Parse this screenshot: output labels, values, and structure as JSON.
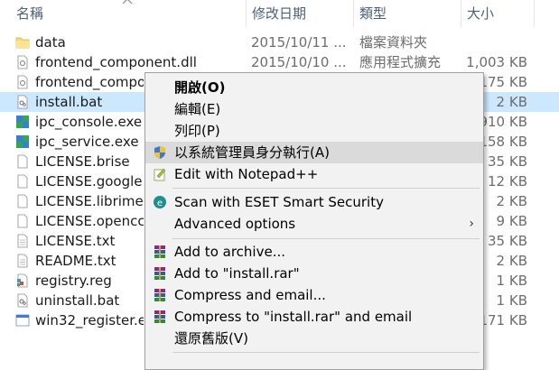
{
  "columns": {
    "name": "名稱",
    "date": "修改日期",
    "type": "類型",
    "size": "大小"
  },
  "files": [
    {
      "name": "data",
      "date": "2015/10/11 ...",
      "type": "檔案資料夾",
      "size": "",
      "icon": "folder-icon"
    },
    {
      "name": "frontend_component.dll",
      "date": "2015/10/10 ...",
      "type": "應用程式擴充",
      "size": "1,003 KB",
      "icon": "dll-file-icon"
    },
    {
      "name": "frontend_compo",
      "date": "",
      "type": "",
      "size": "175 KB",
      "icon": "dll-file-icon"
    },
    {
      "name": "install.bat",
      "date": "",
      "type": "",
      "size": "2 KB",
      "icon": "bat-file-icon"
    },
    {
      "name": "ipc_console.exe",
      "date": "",
      "type": "",
      "size": "910 KB",
      "icon": "exe-file-icon"
    },
    {
      "name": "ipc_service.exe",
      "date": "",
      "type": "",
      "size": "158 KB",
      "icon": "exe-file-icon"
    },
    {
      "name": "LICENSE.brise",
      "date": "",
      "type": "",
      "size": "35 KB",
      "icon": "text-file-icon"
    },
    {
      "name": "LICENSE.google",
      "date": "",
      "type": "",
      "size": "12 KB",
      "icon": "text-file-icon"
    },
    {
      "name": "LICENSE.librime",
      "date": "",
      "type": "",
      "size": "2 KB",
      "icon": "text-file-icon"
    },
    {
      "name": "LICENSE.opencc",
      "date": "",
      "type": "",
      "size": "9 KB",
      "icon": "text-file-icon"
    },
    {
      "name": "LICENSE.txt",
      "date": "",
      "type": "",
      "size": "35 KB",
      "icon": "text-file-icon"
    },
    {
      "name": "README.txt",
      "date": "",
      "type": "",
      "size": "2 KB",
      "icon": "text-file-icon"
    },
    {
      "name": "registry.reg",
      "date": "",
      "type": "",
      "size": "1 KB",
      "icon": "reg-file-icon"
    },
    {
      "name": "uninstall.bat",
      "date": "",
      "type": "",
      "size": "1 KB",
      "icon": "bat-file-icon"
    },
    {
      "name": "win32_register.e",
      "date": "",
      "type": "",
      "size": "171 KB",
      "icon": "exe-file-icon"
    }
  ],
  "menu": {
    "open": "開啟(O)",
    "edit": "編輯(E)",
    "print": "列印(P)",
    "run_as_admin": "以系統管理員身分執行(A)",
    "notepad": "Edit with Notepad++",
    "eset_scan": "Scan with ESET Smart Security",
    "advanced": "Advanced options",
    "add_archive": "Add to archive...",
    "add_rar": "Add to \"install.rar\"",
    "compress_email": "Compress and email...",
    "compress_rar_email": "Compress to \"install.rar\" and email",
    "restore": "還原舊版(V)",
    "submenu_arrow": "›"
  },
  "colors": {
    "selected_row": "#cce8ff",
    "header_text": "#4c607a",
    "menu_bg": "#f2f2f2",
    "menu_hover": "#dadada"
  }
}
